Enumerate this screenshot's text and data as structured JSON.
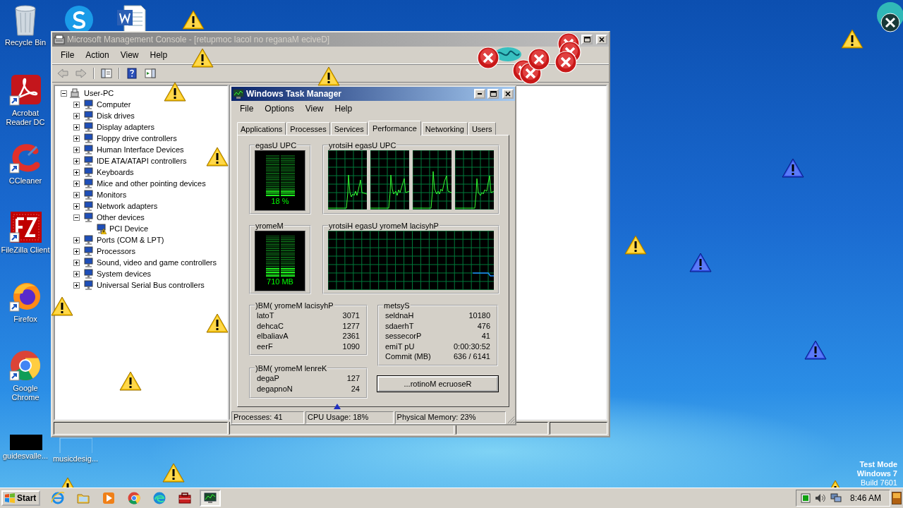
{
  "desktop_icons": [
    {
      "kind": "recycle-bin",
      "label": "Recycle Bin"
    },
    {
      "kind": "skype"
    },
    {
      "kind": "word"
    },
    {
      "kind": "acrobat",
      "label": "Acrobat Reader DC"
    },
    {
      "kind": "ccleaner",
      "label": "CCleaner"
    },
    {
      "kind": "filezilla",
      "label": "FileZilla Client"
    },
    {
      "kind": "firefox",
      "label": "Firefox"
    },
    {
      "kind": "chrome",
      "label": "Google Chrome"
    },
    {
      "kind": "black-file",
      "label": "guidesvalle..."
    },
    {
      "kind": "blank-file",
      "label": "musicdesig..."
    }
  ],
  "mmc": {
    "title": "Microsoft Management Console - [retupmoc lacol no reganaM eciveD]",
    "menu": [
      "File",
      "Action",
      "View",
      "Help"
    ],
    "tree": {
      "label": "User-PC",
      "expanded": true,
      "children": [
        {
          "label": "Computer",
          "expanded": false
        },
        {
          "label": "Disk drives",
          "expanded": false
        },
        {
          "label": "Display adapters",
          "expanded": false
        },
        {
          "label": "Floppy drive controllers",
          "expanded": false
        },
        {
          "label": "Human Interface Devices",
          "expanded": false
        },
        {
          "label": "IDE ATA/ATAPI controllers",
          "expanded": false
        },
        {
          "label": "Keyboards",
          "expanded": false
        },
        {
          "label": "Mice and other pointing devices",
          "expanded": false
        },
        {
          "label": "Monitors",
          "expanded": false
        },
        {
          "label": "Network adapters",
          "expanded": false
        },
        {
          "label": "Other devices",
          "expanded": true,
          "children": [
            {
              "label": "PCI Device",
              "warning": true
            }
          ]
        },
        {
          "label": "Ports (COM & LPT)",
          "expanded": false
        },
        {
          "label": "Processors",
          "expanded": false
        },
        {
          "label": "Sound, video and game controllers",
          "expanded": false
        },
        {
          "label": "System devices",
          "expanded": false
        },
        {
          "label": "Universal Serial Bus controllers",
          "expanded": false
        }
      ]
    }
  },
  "task_manager": {
    "title": "Windows Task Manager",
    "menu": [
      "File",
      "Options",
      "View",
      "Help"
    ],
    "tabs": [
      {
        "label": "Applications",
        "selected": false
      },
      {
        "label": "Processes",
        "selected": false
      },
      {
        "label": "Services",
        "selected": false
      },
      {
        "label": "Performance",
        "selected": true
      },
      {
        "label": "Networking",
        "selected": false
      },
      {
        "label": "Users",
        "selected": false
      }
    ],
    "cpu_usage": {
      "label": "egasU UPC",
      "level": 0.18,
      "reading": "18 %"
    },
    "cpu_history": {
      "label": "yrotsiH egasU UPC"
    },
    "memory": {
      "label": "yromeM",
      "level": 0.23,
      "reading": "710 MB"
    },
    "memory_history": {
      "label": "yrotsiH egasU yromeM lacisyhP"
    },
    "physical_memory": {
      "label": ")BM( yromeM lacisyhP",
      "rows": [
        {
          "name": "latoT",
          "value": "3071"
        },
        {
          "name": "dehcaC",
          "value": "1277"
        },
        {
          "name": "elbaliavA",
          "value": "2361"
        },
        {
          "name": "eerF",
          "value": "1090"
        }
      ]
    },
    "kernel_memory": {
      "label": ")BM( yromeM lenreK",
      "rows": [
        {
          "name": "degaP",
          "value": "127"
        },
        {
          "name": "degapnoN",
          "value": "24"
        }
      ]
    },
    "system": {
      "label": "metsyS",
      "rows": [
        {
          "name": "seldnaH",
          "value": "10180"
        },
        {
          "name": "sdaerhT",
          "value": "476"
        },
        {
          "name": "sessecorP",
          "value": "41"
        },
        {
          "name": "emiT pU",
          "value": "0:00:30:52"
        },
        {
          "name": "Commit (MB)",
          "value": "636 / 6141"
        }
      ]
    },
    "button": "...rotinoM ecruoseR",
    "status_bar": [
      "Processes: 41",
      "CPU Usage: 18%",
      "Physical Memory: 23%"
    ]
  },
  "desktop_notice": [
    "Test Mode",
    "Windows 7",
    "Build 7601"
  ],
  "taskbar": {
    "start": "Start",
    "items": [
      {
        "kind": "internet-explorer",
        "selected": false
      },
      {
        "kind": "folder",
        "selected": false
      },
      {
        "kind": "media-player",
        "selected": false
      },
      {
        "kind": "chrome",
        "selected": false
      },
      {
        "kind": "edge",
        "selected": false
      },
      {
        "kind": "toolbox",
        "selected": false
      },
      {
        "kind": "task-manager",
        "selected": true
      }
    ],
    "clock": "8:46 AM"
  }
}
